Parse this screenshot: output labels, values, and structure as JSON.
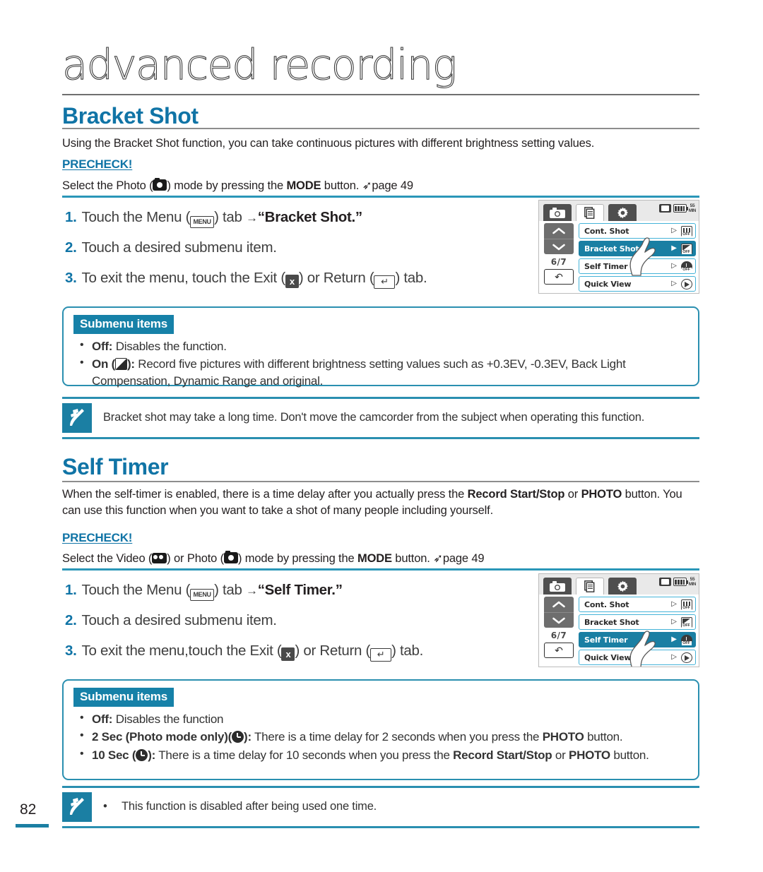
{
  "chapter": {
    "title": "advanced recording"
  },
  "sections": [
    {
      "heading": "Bracket Shot",
      "intro": "Using the Bracket Shot function, you can take continuous pictures with different brightness setting values.",
      "precheck_label": "PRECHECK!",
      "precheck_pre": "Select the Photo (",
      "precheck_mid": ") mode by pressing the ",
      "precheck_mode": "MODE",
      "precheck_post": " button. ",
      "precheck_page": "page 49",
      "steps": [
        {
          "num": "1.",
          "pre": "Touch the Menu (",
          "chip": "MENU",
          "mid": ") tab ",
          "arrow": "→",
          "strong": "“Bracket Shot.”",
          "post": ""
        },
        {
          "num": "2.",
          "pre": "Touch a desired submenu item.",
          "chip": "",
          "mid": "",
          "arrow": "",
          "strong": "",
          "post": ""
        },
        {
          "num": "3.",
          "pre": "To exit the menu, touch the Exit (",
          "chip": "x",
          "mid": ") or Return (",
          "arrow": "",
          "strong": "",
          "post": ") tab."
        }
      ],
      "submenu_badge": "Submenu items",
      "submenu_items": [
        {
          "label": "Off:",
          "text": " Disables the function.",
          "icon": ""
        },
        {
          "label": "On (",
          "icon": "ev-icon",
          "label2": "):",
          "text": " Record five pictures with different brightness setting values such as +0.3EV, -0.3EV, Back Light Compensation, Dynamic Range and original."
        }
      ],
      "note": "Bracket shot may take a long time. Don't move the camcorder from the subject when operating this function."
    },
    {
      "heading": "Self Timer",
      "intro_1_a": "When the self-timer is enabled, there is a time delay after you actually press the ",
      "intro_1_b": "Record Start/Stop",
      "intro_1_c": " or ",
      "intro_1_d": "PHOTO",
      "intro_2": "button. You can use this function when you want to take a shot of many people including yourself.",
      "precheck_label": "PRECHECK!",
      "precheck_pre": "Select the Video (",
      "precheck_mid": ") or Photo (",
      "precheck_mid2": ") mode by pressing the ",
      "precheck_mode": "MODE",
      "precheck_post": " button. ",
      "precheck_page": "page 49",
      "steps": [
        {
          "num": "1.",
          "pre": "Touch the Menu (",
          "chip": "MENU",
          "mid": ") tab ",
          "arrow": "→",
          "strong": "“Self Timer.”",
          "post": ""
        },
        {
          "num": "2.",
          "pre": "Touch a desired submenu item.",
          "chip": "",
          "mid": "",
          "arrow": "",
          "strong": "",
          "post": ""
        },
        {
          "num": "3.",
          "pre": "To exit the menu,touch the Exit (",
          "chip": "x",
          "mid": ") or Return (",
          "arrow": "",
          "strong": "",
          "post": ") tab."
        }
      ],
      "submenu_badge": "Submenu items",
      "submenu_items": [
        {
          "label": "Off:",
          "text": " Disables the function"
        },
        {
          "label": "2 Sec (Photo mode only)(",
          "label2": "):",
          "text": " There is a time delay for 2 seconds when you press the ",
          "bold_tail": "PHOTO",
          "tail": " button."
        },
        {
          "label": "10 Sec (",
          "label2": "):",
          "text": " There is a time delay for 10 seconds when you press the ",
          "bold_tail": "Record Start/Stop",
          "tail": " or ",
          "bold_tail2": "PHOTO",
          "tail2": " button."
        }
      ],
      "note_bullet": "•",
      "note": "This function is disabled after being used one time."
    }
  ],
  "lcd_screens": [
    {
      "tabs": [
        "photo-tab",
        "menu-tab",
        "settings-tab"
      ],
      "status": {
        "sd": "sd-card-icon",
        "battery": "battery-icon",
        "time_unit_top": "55",
        "time_unit_bottom": "MIN"
      },
      "page_indicator": "6/7",
      "return_label": "↶",
      "rows": [
        {
          "label": "Cont. Shot",
          "icon": "cont-shot-icon",
          "icon_off": "OFF",
          "selected": false
        },
        {
          "label": "Bracket Shot",
          "icon": "bracket-shot-icon",
          "icon_off": "OFF",
          "selected": true
        },
        {
          "label": "Self Timer",
          "icon": "self-timer-icon",
          "icon_off": "OFF",
          "selected": false
        },
        {
          "label": "Quick View",
          "icon": "quick-view-icon",
          "icon_off": "",
          "selected": false
        }
      ]
    },
    {
      "tabs": [
        "photo-tab",
        "menu-tab",
        "settings-tab"
      ],
      "status": {
        "sd": "sd-card-icon",
        "battery": "battery-icon",
        "time_unit_top": "55",
        "time_unit_bottom": "MIN"
      },
      "page_indicator": "6/7",
      "return_label": "↶",
      "rows": [
        {
          "label": "Cont. Shot",
          "icon": "cont-shot-icon",
          "icon_off": "OFF",
          "selected": false
        },
        {
          "label": "Bracket Shot",
          "icon": "bracket-shot-icon",
          "icon_off": "OFF",
          "selected": false
        },
        {
          "label": "Self Timer",
          "icon": "self-timer-icon",
          "icon_off": "OFF",
          "selected": true
        },
        {
          "label": "Quick View",
          "icon": "quick-view-icon",
          "icon_off": "",
          "selected": false
        }
      ]
    }
  ],
  "footer": {
    "page_number": "82"
  },
  "colors": {
    "heading": "#1074a6",
    "badge": "#1681a8",
    "rule": "#2a8fb0",
    "lcd_selected": "#1a7fa3",
    "lcd_row_border": "#45b3d8"
  }
}
